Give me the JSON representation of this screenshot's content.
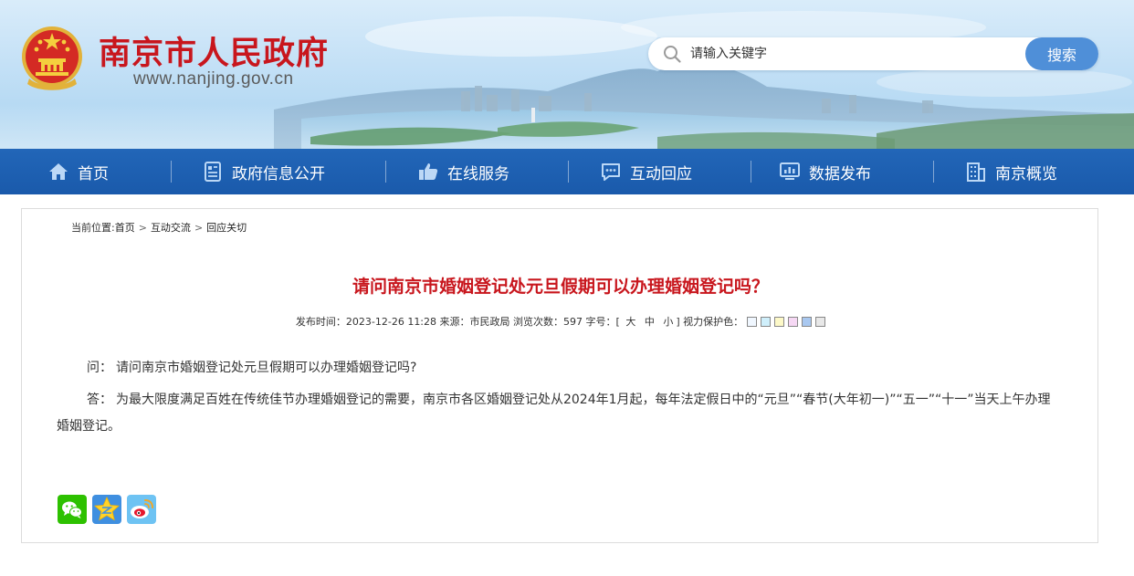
{
  "header": {
    "site_title": "南京市人民政府",
    "site_url": "www.nanjing.gov.cn"
  },
  "search": {
    "placeholder": "请输入关键字",
    "button_label": "搜索"
  },
  "nav": {
    "items": [
      {
        "label": "首页",
        "icon": "home-icon"
      },
      {
        "label": "政府信息公开",
        "icon": "document-icon"
      },
      {
        "label": "在线服务",
        "icon": "thumbs-up-icon"
      },
      {
        "label": "互动回应",
        "icon": "chat-icon"
      },
      {
        "label": "数据发布",
        "icon": "monitor-chart-icon"
      },
      {
        "label": "南京概览",
        "icon": "building-icon"
      }
    ]
  },
  "breadcrumb": {
    "prefix": "当前位置:",
    "items": [
      "首页",
      "互动交流",
      "回应关切"
    ],
    "separator": ">"
  },
  "article": {
    "title": "请问南京市婚姻登记处元旦假期可以办理婚姻登记吗？",
    "meta": {
      "publish_label": "发布时间：",
      "publish_time": "2023-12-26 11:28",
      "source_label": "来源：",
      "source": "市民政局",
      "views_label": "浏览次数：",
      "views": "597",
      "fontsize_label": "字号：",
      "fontsize_open": "[",
      "fontsize_large": "大",
      "fontsize_medium": "中",
      "fontsize_small": "小",
      "fontsize_close": "]",
      "eye_care_label": "视力保护色："
    },
    "eye_care_colors": [
      "#f0f7ff",
      "#cfeffb",
      "#fdf9c8",
      "#f6d8f4",
      "#a9c8f0",
      "#e8e8e8"
    ],
    "question_label": "问：",
    "question": "请问南京市婚姻登记处元旦假期可以办理婚姻登记吗?",
    "answer_label": "答：",
    "answer": "为最大限度满足百姓在传统佳节办理婚姻登记的需要，南京市各区婚姻登记处从2024年1月起，每年法定假日中的“元旦”“春节(大年初一)”“五一”“十一”当天上午办理婚姻登记。"
  },
  "share": {
    "icons": [
      "wechat-icon",
      "qzone-icon",
      "weibo-icon"
    ]
  },
  "colors": {
    "brand_red": "#c8161d",
    "nav_blue": "#1a5aab",
    "search_button": "#4f8fd8"
  }
}
